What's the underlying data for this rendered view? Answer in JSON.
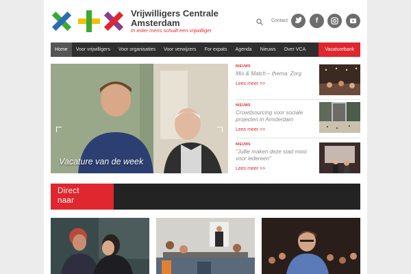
{
  "header": {
    "brand_name_line1": "Vrijwilligers Centrale",
    "brand_name_line2": "Amsterdam",
    "tagline": "In ieder mens schuilt een vrijwilliger",
    "contact_label": "Contact",
    "social": [
      {
        "name": "twitter-icon",
        "glyph": "🐦"
      },
      {
        "name": "facebook-icon",
        "glyph": "f"
      },
      {
        "name": "instagram-icon",
        "glyph": "◎"
      },
      {
        "name": "youtube-icon",
        "glyph": "▶"
      }
    ]
  },
  "nav": {
    "items": [
      "Home",
      "Voor vrijwilligers",
      "Voor organisaties",
      "Voor verwijzers",
      "For expats",
      "Agenda",
      "Nieuws",
      "Over VCA"
    ],
    "cta": "Vacaturebank"
  },
  "hero": {
    "caption": "Vacature van de week"
  },
  "news": [
    {
      "category": "NIEUWS",
      "title": "Mix & Match – thema: Zorg",
      "more": "Lees meer >>"
    },
    {
      "category": "NIEUWS",
      "title": "Crowdsourcing voor sociale projecten in Amsterdam",
      "more": "Lees meer >>"
    },
    {
      "category": "NIEUWS",
      "title": "\"Jullie maken deze stad mooi voor iedereen\"",
      "more": "Lees meer >>"
    }
  ],
  "direct": {
    "label_line1": "Direct",
    "label_line2": "naar"
  },
  "colors": {
    "accent": "#e0262e",
    "nav_bg": "#2f2f2f",
    "logo_green": "#3aaa35",
    "logo_blue": "#2a6db5",
    "logo_yellow": "#f2c200",
    "logo_purple": "#8d3c8f",
    "logo_red": "#e0262e"
  }
}
